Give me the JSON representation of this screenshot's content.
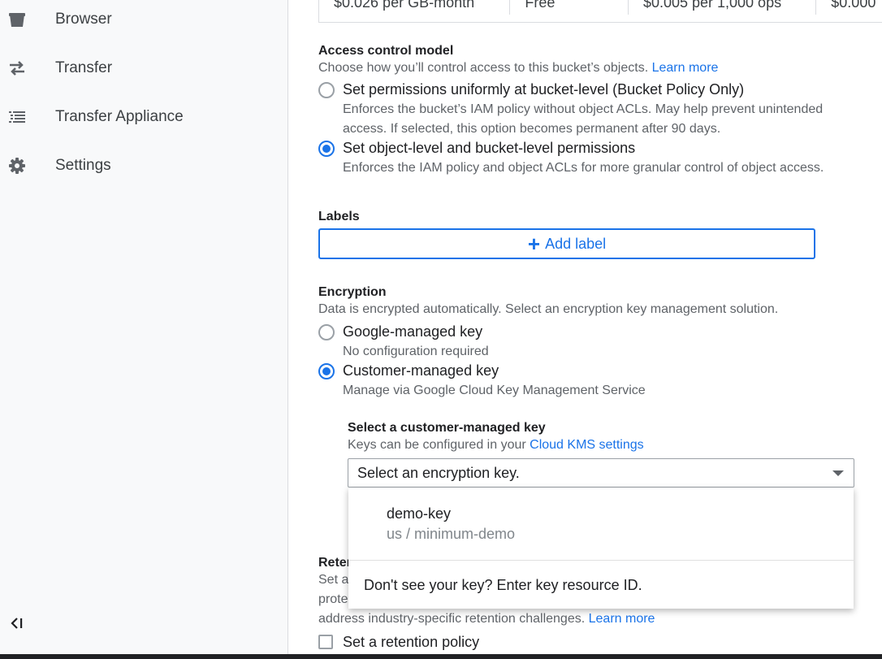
{
  "sidebar": {
    "items": [
      {
        "label": "Browser",
        "icon": "bucket-icon"
      },
      {
        "label": "Transfer",
        "icon": "transfer-arrows-icon"
      },
      {
        "label": "Transfer Appliance",
        "icon": "list-icon"
      },
      {
        "label": "Settings",
        "icon": "gear-icon"
      }
    ],
    "collapse_icon": "collapse-left-icon"
  },
  "pricing": {
    "cells": [
      "$0.026 per GB-month",
      "Free",
      "$0.005 per 1,000 ops",
      "$0.000"
    ]
  },
  "access_control": {
    "title": "Access control model",
    "description": "Choose how you’ll control access to this bucket’s objects.",
    "learn_more": "Learn more",
    "options": [
      {
        "label": "Set permissions uniformly at bucket-level (Bucket Policy Only)",
        "description": "Enforces the bucket’s IAM policy without object ACLs. May help prevent unintended access. If selected, this option becomes permanent after 90 days.",
        "selected": false
      },
      {
        "label": "Set object-level and bucket-level permissions",
        "description": "Enforces the IAM policy and object ACLs for more granular control of object access.",
        "selected": true
      }
    ]
  },
  "labels": {
    "title": "Labels",
    "add_button": "Add label"
  },
  "encryption": {
    "title": "Encryption",
    "description": "Data is encrypted automatically. Select an encryption key management solution.",
    "options": [
      {
        "label": "Google-managed key",
        "description": "No configuration required",
        "selected": false
      },
      {
        "label": "Customer-managed key",
        "description": "Manage via Google Cloud Key Management Service",
        "selected": true
      }
    ],
    "cmk": {
      "title": "Select a customer-managed key",
      "description": "Keys can be configured in your",
      "kms_link": "Cloud KMS settings",
      "select_placeholder": "Select an encryption key."
    },
    "dropdown": {
      "items": [
        {
          "name": "demo-key",
          "location": "us / minimum-demo"
        }
      ],
      "footer": "Don't see your key? Enter key resource ID."
    }
  },
  "retention": {
    "title_partial": "Reter",
    "desc_line1": "Set a",
    "desc_line2": "prote",
    "desc_line3": "address industry-specific retention challenges.",
    "learn_more": "Learn more",
    "checkbox_label": "Set a retention policy"
  },
  "colors": {
    "accent": "#1a73e8",
    "sidebar_bg": "#f8f9fa",
    "text_primary": "#202124",
    "text_secondary": "#5f6368"
  }
}
